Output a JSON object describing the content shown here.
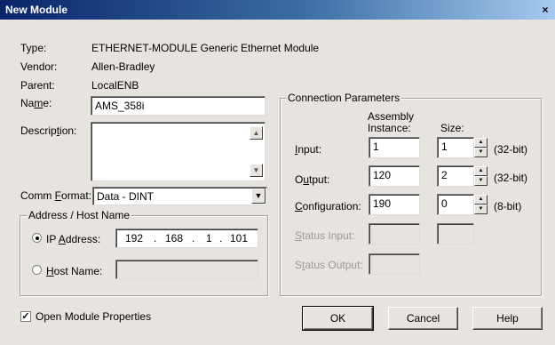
{
  "window": {
    "title": "New Module",
    "close_glyph": "×"
  },
  "info": {
    "type_label": "Type:",
    "type_value": "ETHERNET-MODULE Generic Ethernet Module",
    "vendor_label": "Vendor:",
    "vendor_value": "Allen-Bradley",
    "parent_label": "Parent:",
    "parent_value": "LocalENB"
  },
  "name": {
    "label_pre": "Na",
    "label_u": "m",
    "label_post": "e:",
    "value": "AMS_358i"
  },
  "description": {
    "label_pre": "Descrip",
    "label_u": "t",
    "label_post": "ion:",
    "value": ""
  },
  "comm_format": {
    "label_pre": "Comm ",
    "label_u": "F",
    "label_post": "ormat:",
    "value": "Data - DINT"
  },
  "address": {
    "group_label": "Address / Host Name",
    "ip_label_pre": "IP ",
    "ip_label_u": "A",
    "ip_label_post": "ddress:",
    "ip_octets": [
      "192",
      "168",
      "1",
      "101"
    ],
    "ip_selected": true,
    "host_label_pre": "",
    "host_label_u": "H",
    "host_label_post": "ost Name:",
    "host_value": ""
  },
  "connection": {
    "group_label": "Connection Parameters",
    "col_assembly_line1": "Assembly",
    "col_assembly_line2": "Instance:",
    "col_size": "Size:",
    "rows": [
      {
        "label_pre": "",
        "label_u": "I",
        "label_post": "nput:",
        "instance": "1",
        "size": "1",
        "unit": "(32-bit)"
      },
      {
        "label_pre": "O",
        "label_u": "u",
        "label_post": "tput:",
        "instance": "120",
        "size": "2",
        "unit": "(32-bit)"
      },
      {
        "label_pre": "",
        "label_u": "C",
        "label_post": "onfiguration:",
        "instance": "190",
        "size": "0",
        "unit": "(8-bit)"
      }
    ],
    "status_input_pre": "",
    "status_input_u": "S",
    "status_input_post": "tatus Input:",
    "status_output_pre": "S",
    "status_output_u": "t",
    "status_output_post": "atus Output:"
  },
  "footer": {
    "open_props_label": "Open Module Properties",
    "open_props_checked": true,
    "ok": "OK",
    "cancel": "Cancel",
    "help": "Help"
  }
}
